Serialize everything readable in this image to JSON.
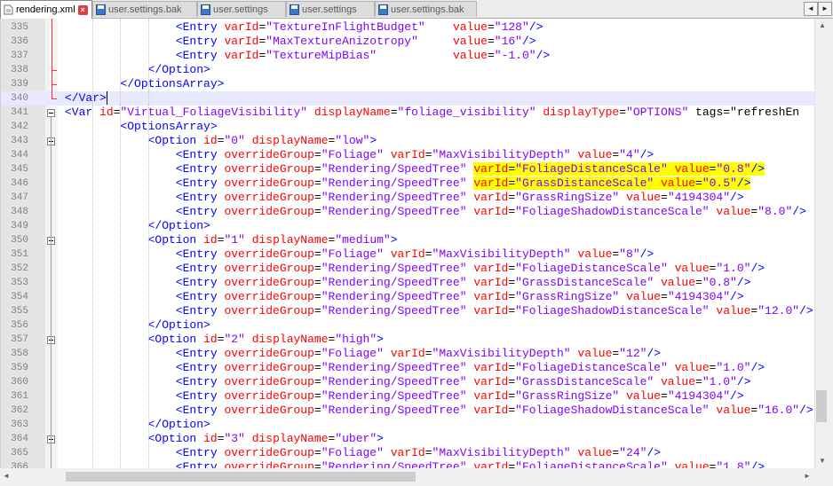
{
  "tabs": [
    {
      "label": "rendering.xml",
      "active": true,
      "icon": "file-icon",
      "closable": true
    },
    {
      "label": "user.settings.bak",
      "active": false,
      "icon": "save-disk-icon"
    },
    {
      "label": "user.settings",
      "active": false,
      "icon": "save-disk-icon"
    },
    {
      "label": "user.settings",
      "active": false,
      "icon": "save-disk-icon"
    },
    {
      "label": "user.settings.bak",
      "active": false,
      "icon": "save-disk-icon"
    }
  ],
  "tab_nav": {
    "prev": "◄",
    "next": "►"
  },
  "colors": {
    "tag": "#0000ff",
    "attr": "#ff0000",
    "value": "#8000ff",
    "highlight": "#ffff00",
    "current_line": "#e8e8ff"
  },
  "lines": [
    {
      "n": "335",
      "code": "                <Entry varId=\"TextureInFlightBudget\"    value=\"128\"/>"
    },
    {
      "n": "336",
      "code": "                <Entry varId=\"MaxTextureAnizotropy\"     value=\"16\"/>"
    },
    {
      "n": "337",
      "code": "                <Entry varId=\"TextureMipBias\"           value=\"-1.0\"/>"
    },
    {
      "n": "338",
      "code": "            </Option>"
    },
    {
      "n": "339",
      "code": "        </OptionsArray>"
    },
    {
      "n": "340",
      "code": "</Var>"
    },
    {
      "n": "341",
      "code": "<Var id=\"Virtual_FoliageVisibility\" displayName=\"foliage_visibility\" displayType=\"OPTIONS\" tags=\"refreshEn"
    },
    {
      "n": "342",
      "code": "        <OptionsArray>"
    },
    {
      "n": "343",
      "code": "            <Option id=\"0\" displayName=\"low\">"
    },
    {
      "n": "344",
      "code": "                <Entry overrideGroup=\"Foliage\" varId=\"MaxVisibilityDepth\" value=\"4\"/>"
    },
    {
      "n": "345",
      "code": "                <Entry overrideGroup=\"Rendering/SpeedTree\" varId=\"FoliageDistanceScale\" value=\"0.8\"/>"
    },
    {
      "n": "346",
      "code": "                <Entry overrideGroup=\"Rendering/SpeedTree\" varId=\"GrassDistanceScale\" value=\"0.5\"/>"
    },
    {
      "n": "347",
      "code": "                <Entry overrideGroup=\"Rendering/SpeedTree\" varId=\"GrassRingSize\" value=\"4194304\"/>"
    },
    {
      "n": "348",
      "code": "                <Entry overrideGroup=\"Rendering/SpeedTree\" varId=\"FoliageShadowDistanceScale\" value=\"8.0\"/>"
    },
    {
      "n": "349",
      "code": "            </Option>"
    },
    {
      "n": "350",
      "code": "            <Option id=\"1\" displayName=\"medium\">"
    },
    {
      "n": "351",
      "code": "                <Entry overrideGroup=\"Foliage\" varId=\"MaxVisibilityDepth\" value=\"8\"/>"
    },
    {
      "n": "352",
      "code": "                <Entry overrideGroup=\"Rendering/SpeedTree\" varId=\"FoliageDistanceScale\" value=\"1.0\"/>"
    },
    {
      "n": "353",
      "code": "                <Entry overrideGroup=\"Rendering/SpeedTree\" varId=\"GrassDistanceScale\" value=\"0.8\"/>"
    },
    {
      "n": "354",
      "code": "                <Entry overrideGroup=\"Rendering/SpeedTree\" varId=\"GrassRingSize\" value=\"4194304\"/>"
    },
    {
      "n": "355",
      "code": "                <Entry overrideGroup=\"Rendering/SpeedTree\" varId=\"FoliageShadowDistanceScale\" value=\"12.0\"/>"
    },
    {
      "n": "356",
      "code": "            </Option>"
    },
    {
      "n": "357",
      "code": "            <Option id=\"2\" displayName=\"high\">"
    },
    {
      "n": "358",
      "code": "                <Entry overrideGroup=\"Foliage\" varId=\"MaxVisibilityDepth\" value=\"12\"/>"
    },
    {
      "n": "359",
      "code": "                <Entry overrideGroup=\"Rendering/SpeedTree\" varId=\"FoliageDistanceScale\" value=\"1.0\"/>"
    },
    {
      "n": "360",
      "code": "                <Entry overrideGroup=\"Rendering/SpeedTree\" varId=\"GrassDistanceScale\" value=\"1.0\"/>"
    },
    {
      "n": "361",
      "code": "                <Entry overrideGroup=\"Rendering/SpeedTree\" varId=\"GrassRingSize\" value=\"4194304\"/>"
    },
    {
      "n": "362",
      "code": "                <Entry overrideGroup=\"Rendering/SpeedTree\" varId=\"FoliageShadowDistanceScale\" value=\"16.0\"/>"
    },
    {
      "n": "363",
      "code": "            </Option>"
    },
    {
      "n": "364",
      "code": "            <Option id=\"3\" displayName=\"uber\">"
    },
    {
      "n": "365",
      "code": "                <Entry overrideGroup=\"Foliage\" varId=\"MaxVisibilityDepth\" value=\"24\"/>"
    },
    {
      "n": "366",
      "code": "                <Entry overrideGroup=\"Rendering/SpeedTree\" varId=\"FoliageDistanceScale\" value=\"1.8\"/>"
    }
  ],
  "current_line": "340",
  "fold_lines": [
    "341",
    "343",
    "350",
    "357",
    "364"
  ],
  "highlighted_lines": [
    "345",
    "346"
  ]
}
